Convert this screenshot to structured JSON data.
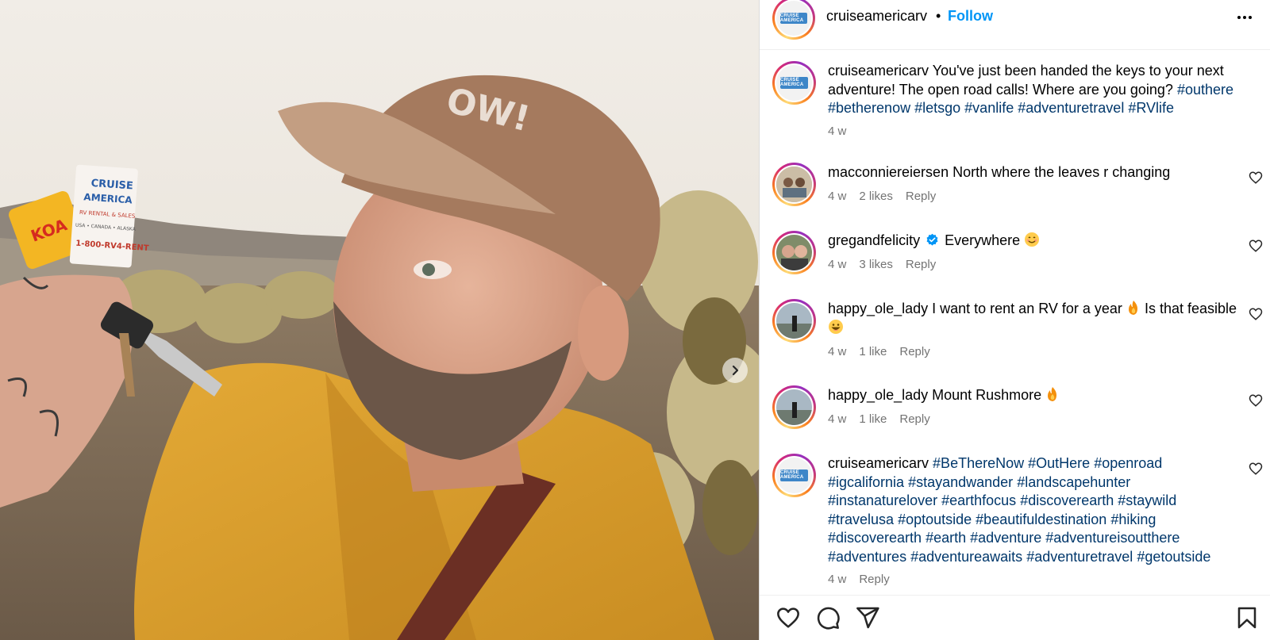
{
  "post": {
    "author": "cruiseamericarv",
    "separator": "•",
    "follow_label": "Follow",
    "logo_text": "CRUISE AMERICA"
  },
  "photo": {
    "keytag_lines": [
      "CRUISE",
      "AMERICA",
      "RV RENTAL & SALES",
      "USA • CANADA • ALASKA",
      "1-800-RV4-RENT"
    ],
    "koa_text": "KOA",
    "cap_text": "OW!"
  },
  "caption": {
    "username": "cruiseamericarv",
    "text": "You've just been handed the keys to your next adventure! The open road calls! Where are you going?",
    "hashtags": [
      "#outhere",
      "#betherenow",
      "#letsgo",
      "#vanlife",
      "#adventuretravel",
      "#RVlife"
    ],
    "time": "4 w"
  },
  "comments": [
    {
      "username": "macconniereiersen",
      "text": "North where the leaves r changing",
      "time": "4 w",
      "likes": "2 likes",
      "reply": "Reply"
    },
    {
      "username": "gregandfelicity",
      "text": "Everywhere",
      "emoji": "smile",
      "verified": true,
      "time": "4 w",
      "likes": "3 likes",
      "reply": "Reply"
    },
    {
      "username": "happy_ole_lady",
      "text_a": "I want to rent an RV for a year",
      "text_b": "Is that feasible",
      "time": "4 w",
      "likes": "1 like",
      "reply": "Reply"
    },
    {
      "username": "happy_ole_lady",
      "text": "Mount Rushmore",
      "time": "4 w",
      "likes": "1 like",
      "reply": "Reply"
    },
    {
      "username": "cruiseamericarv",
      "hashtags": [
        "#BeThereNow",
        "#OutHere",
        "#openroad",
        "#igcalifornia",
        "#stayandwander",
        "#landscapehunter",
        "#instanaturelover",
        "#earthfocus",
        "#discoverearth",
        "#staywild",
        "#travelusa",
        "#optoutside",
        "#beautifuldestination",
        "#hiking",
        "#discoverearth",
        "#earth",
        "#adventure",
        "#adventureisoutthere",
        "#adventures",
        "#adventureawaits",
        "#adventuretravel",
        "#getoutside"
      ],
      "time": "4 w",
      "reply": "Reply"
    }
  ],
  "colors": {
    "follow": "#0095f6",
    "hashtag": "#00376b",
    "meta": "#737373",
    "verified": "#0095f6"
  },
  "icons": [
    "more-options-icon",
    "heart-icon",
    "comment-icon",
    "share-icon",
    "bookmark-icon",
    "chevron-right-icon",
    "verified-badge-icon",
    "fire-emoji",
    "smile-emoji",
    "grin-emoji"
  ]
}
